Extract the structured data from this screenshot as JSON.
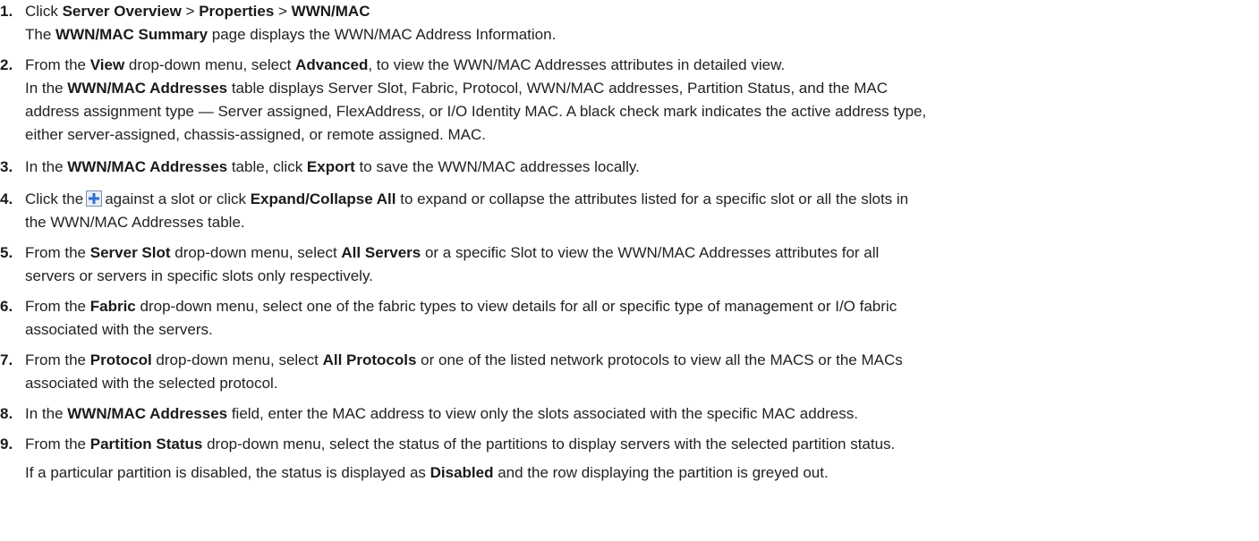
{
  "steps": [
    {
      "num": "1.",
      "l1_a": "Click ",
      "l1_b1": "Server Overview",
      "l1_sep1": " > ",
      "l1_b2": "Properties",
      "l1_sep2": " > ",
      "l1_b3": "WWN/MAC",
      "l2_a": "The ",
      "l2_b1": "WWN/MAC Summary",
      "l2_c": " page displays the WWN/MAC Address Information."
    },
    {
      "num": "2.",
      "l1_a": "From the ",
      "l1_b1": "View",
      "l1_c": " drop-down menu, select ",
      "l1_b2": "Advanced",
      "l1_d": ", to view the WWN/MAC Addresses attributes in detailed view.",
      "l2_a": "In the ",
      "l2_b1": "WWN/MAC Addresses",
      "l2_c": " table displays Server Slot, Fabric, Protocol, WWN/MAC addresses, Partition Status, and the MAC",
      "l3": "address assignment type — Server assigned, FlexAddress, or I/O Identity MAC. A black check mark indicates the active address type,",
      "l4": "either server-assigned, chassis-assigned, or remote assigned. MAC."
    },
    {
      "num": "3.",
      "l1_a": "In the ",
      "l1_b1": "WWN/MAC Addresses",
      "l1_c": " table, click ",
      "l1_b2": "Export",
      "l1_d": " to save the WWN/MAC addresses locally."
    },
    {
      "num": "4.",
      "l1_a": "Click the",
      "l1_c": "against a slot or click ",
      "l1_b1": "Expand/Collapse All",
      "l1_d": " to expand or collapse the attributes listed for a specific slot or all the slots in",
      "l2": "the WWN/MAC Addresses table."
    },
    {
      "num": "5.",
      "l1_a": "From the ",
      "l1_b1": "Server Slot",
      "l1_c": " drop-down menu, select ",
      "l1_b2": "All Servers",
      "l1_d": " or a specific Slot to view the WWN/MAC Addresses attributes for all",
      "l2": "servers or servers in specific slots only respectively."
    },
    {
      "num": "6.",
      "l1_a": "From the ",
      "l1_b1": "Fabric",
      "l1_c": " drop-down menu, select one of the fabric types to view details for all or specific type of management or I/O fabric",
      "l2": "associated with the servers."
    },
    {
      "num": "7.",
      "l1_a": "From the ",
      "l1_b1": "Protocol",
      "l1_c": " drop-down menu, select ",
      "l1_b2": "All Protocols",
      "l1_d": " or one of the listed network protocols to view all the MACS or the MACs",
      "l2": "associated with the selected protocol."
    },
    {
      "num": "8.",
      "l1_a": "In the ",
      "l1_b1": "WWN/MAC Addresses",
      "l1_c": " field, enter the MAC address to view only the slots associated with the specific MAC address."
    },
    {
      "num": "9.",
      "l1_a": "From the ",
      "l1_b1": "Partition Status",
      "l1_c": " drop-down menu, select the status of the partitions to display servers with the selected partition status.",
      "l2_a": "If a particular partition is disabled, the status is displayed as ",
      "l2_b1": "Disabled",
      "l2_c": " and the row displaying the partition is greyed out."
    }
  ],
  "icons": {
    "expand": "plus-box-icon"
  },
  "colors": {
    "plus_fill": "#2e6fd4",
    "plus_border": "#7a8fa8",
    "plus_bg": "#e8eef5"
  }
}
